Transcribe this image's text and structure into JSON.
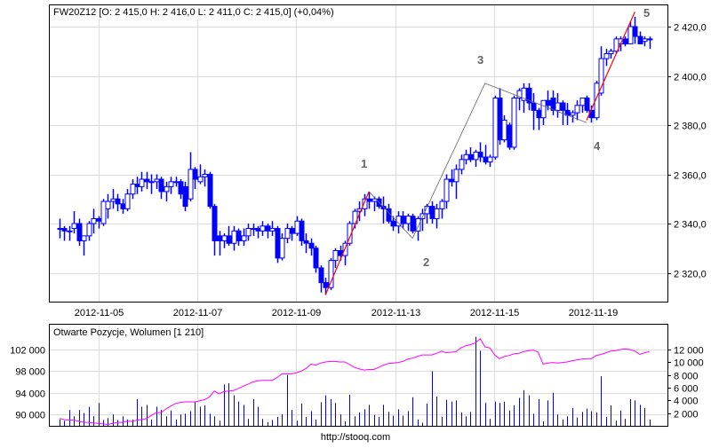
{
  "chart_data": [
    {
      "type": "candlestick",
      "title": "FW20Z12 [O: 2 415,0  H: 2 416,0  L: 2 411,0  C: 2 415,0] (+0,04%)",
      "colors": {
        "candle": "#0000ff",
        "grid": "#dcdcdc",
        "wave_up": "#ff0000",
        "wave_line": "#666666"
      },
      "ylim": [
        2308,
        2428
      ],
      "y_ticks": [
        {
          "value": 2420,
          "label": "2 420,0"
        },
        {
          "value": 2400,
          "label": "2 400,0"
        },
        {
          "value": 2380,
          "label": "2 380,0"
        },
        {
          "value": 2360,
          "label": "2 360,0"
        },
        {
          "value": 2340,
          "label": "2 340,0"
        },
        {
          "value": 2320,
          "label": "2 320,0"
        }
      ],
      "x_ticks": [
        {
          "bar": 8.1,
          "label": "2012-11-05"
        },
        {
          "bar": 28.5,
          "label": "2012-11-07"
        },
        {
          "bar": 48.9,
          "label": "2012-11-09"
        },
        {
          "bar": 69.5,
          "label": "2012-11-13"
        },
        {
          "bar": 89.9,
          "label": "2012-11-15"
        },
        {
          "bar": 110.3,
          "label": "2012-11-19"
        }
      ],
      "ohlc": [
        [
          2338,
          2342,
          2334,
          2338
        ],
        [
          2338,
          2339,
          2333,
          2337
        ],
        [
          2337,
          2339,
          2333,
          2337
        ],
        [
          2338,
          2345,
          2336,
          2340
        ],
        [
          2340,
          2342,
          2331,
          2333
        ],
        [
          2333,
          2335,
          2327,
          2335
        ],
        [
          2335,
          2341,
          2333,
          2340
        ],
        [
          2340,
          2346,
          2336,
          2342
        ],
        [
          2342,
          2343,
          2338,
          2341
        ],
        [
          2340,
          2350,
          2339,
          2349
        ],
        [
          2346,
          2352,
          2342,
          2349
        ],
        [
          2349,
          2354,
          2346,
          2350
        ],
        [
          2350,
          2352,
          2345,
          2348
        ],
        [
          2348,
          2350,
          2344,
          2346
        ],
        [
          2346,
          2354,
          2345,
          2352
        ],
        [
          2352,
          2358,
          2350,
          2356
        ],
        [
          2356,
          2359,
          2352,
          2355
        ],
        [
          2355,
          2361,
          2353,
          2358
        ],
        [
          2358,
          2361,
          2354,
          2357
        ],
        [
          2357,
          2360,
          2352,
          2357
        ],
        [
          2357,
          2360,
          2354,
          2358
        ],
        [
          2358,
          2359,
          2350,
          2353
        ],
        [
          2353,
          2357,
          2349,
          2355
        ],
        [
          2355,
          2359,
          2352,
          2357
        ],
        [
          2357,
          2359,
          2355,
          2357
        ],
        [
          2357,
          2358,
          2350,
          2352
        ],
        [
          2355,
          2357,
          2345,
          2347
        ],
        [
          2350,
          2369,
          2349,
          2362
        ],
        [
          2362,
          2363,
          2354,
          2358
        ],
        [
          2357,
          2364,
          2356,
          2359
        ],
        [
          2359,
          2362,
          2355,
          2360
        ],
        [
          2360,
          2361,
          2346,
          2347
        ],
        [
          2347,
          2348,
          2327,
          2333
        ],
        [
          2335,
          2337,
          2327,
          2333
        ],
        [
          2333,
          2336,
          2330,
          2335
        ],
        [
          2335,
          2339,
          2331,
          2332
        ],
        [
          2332,
          2339,
          2329,
          2337
        ],
        [
          2337,
          2338,
          2331,
          2333
        ],
        [
          2333,
          2338,
          2331,
          2335
        ],
        [
          2335,
          2340,
          2333,
          2338
        ],
        [
          2338,
          2340,
          2335,
          2338
        ],
        [
          2338,
          2339,
          2334,
          2337
        ],
        [
          2337,
          2341,
          2335,
          2339
        ],
        [
          2339,
          2340,
          2334,
          2337
        ],
        [
          2337,
          2341,
          2335,
          2338
        ],
        [
          2338,
          2339,
          2324,
          2326
        ],
        [
          2326,
          2336,
          2325,
          2334
        ],
        [
          2334,
          2340,
          2332,
          2338
        ],
        [
          2338,
          2339,
          2333,
          2336
        ],
        [
          2336,
          2343,
          2335,
          2341
        ],
        [
          2341,
          2342,
          2331,
          2333
        ],
        [
          2333,
          2336,
          2328,
          2332
        ],
        [
          2332,
          2334,
          2327,
          2330
        ],
        [
          2330,
          2331,
          2320,
          2322
        ],
        [
          2322,
          2323,
          2312,
          2316
        ],
        [
          2316,
          2318,
          2311,
          2314
        ],
        [
          2314,
          2326,
          2313,
          2325
        ],
        [
          2325,
          2330,
          2322,
          2329
        ],
        [
          2329,
          2331,
          2325,
          2327
        ],
        [
          2327,
          2333,
          2323,
          2332
        ],
        [
          2332,
          2341,
          2331,
          2340
        ],
        [
          2340,
          2346,
          2338,
          2345
        ],
        [
          2345,
          2349,
          2341,
          2346
        ],
        [
          2346,
          2352,
          2343,
          2350
        ],
        [
          2350,
          2353,
          2346,
          2349
        ],
        [
          2349,
          2351,
          2345,
          2350
        ],
        [
          2350,
          2351,
          2346,
          2347
        ],
        [
          2347,
          2351,
          2340,
          2346
        ],
        [
          2346,
          2348,
          2340,
          2341
        ],
        [
          2341,
          2343,
          2337,
          2339
        ],
        [
          2339,
          2345,
          2336,
          2343
        ],
        [
          2343,
          2345,
          2338,
          2340
        ],
        [
          2340,
          2344,
          2337,
          2343
        ],
        [
          2343,
          2344,
          2336,
          2337
        ],
        [
          2337,
          2343,
          2333,
          2342
        ],
        [
          2342,
          2346,
          2337,
          2344
        ],
        [
          2344,
          2348,
          2340,
          2347
        ],
        [
          2347,
          2349,
          2340,
          2342
        ],
        [
          2342,
          2348,
          2338,
          2346
        ],
        [
          2346,
          2350,
          2342,
          2349
        ],
        [
          2349,
          2360,
          2346,
          2358
        ],
        [
          2358,
          2362,
          2355,
          2357
        ],
        [
          2357,
          2364,
          2350,
          2362
        ],
        [
          2362,
          2368,
          2360,
          2366
        ],
        [
          2366,
          2370,
          2364,
          2368
        ],
        [
          2368,
          2371,
          2365,
          2366
        ],
        [
          2366,
          2370,
          2363,
          2369
        ],
        [
          2369,
          2373,
          2365,
          2367
        ],
        [
          2367,
          2372,
          2364,
          2365
        ],
        [
          2365,
          2368,
          2363,
          2367
        ],
        [
          2367,
          2392,
          2366,
          2391
        ],
        [
          2391,
          2395,
          2372,
          2374
        ],
        [
          2374,
          2384,
          2373,
          2382
        ],
        [
          2380,
          2381,
          2370,
          2371
        ],
        [
          2371,
          2392,
          2370,
          2391
        ],
        [
          2391,
          2395,
          2386,
          2394
        ],
        [
          2390,
          2397,
          2385,
          2395
        ],
        [
          2395,
          2397,
          2386,
          2389
        ],
        [
          2389,
          2393,
          2378,
          2386
        ],
        [
          2386,
          2387,
          2378,
          2383
        ],
        [
          2383,
          2390,
          2380,
          2390
        ],
        [
          2390,
          2394,
          2386,
          2388
        ],
        [
          2391,
          2394,
          2384,
          2386
        ],
        [
          2386,
          2393,
          2383,
          2389
        ],
        [
          2389,
          2390,
          2380,
          2386
        ],
        [
          2386,
          2389,
          2380,
          2384
        ],
        [
          2384,
          2386,
          2381,
          2385
        ],
        [
          2385,
          2390,
          2382,
          2388
        ],
        [
          2388,
          2391,
          2385,
          2391
        ],
        [
          2391,
          2392,
          2385,
          2386
        ],
        [
          2386,
          2388,
          2381,
          2383
        ],
        [
          2383,
          2398,
          2382,
          2397
        ],
        [
          2393,
          2412,
          2392,
          2407
        ],
        [
          2407,
          2411,
          2404,
          2409
        ],
        [
          2409,
          2411,
          2407,
          2410
        ],
        [
          2410,
          2416,
          2409,
          2415
        ],
        [
          2413,
          2416,
          2410,
          2415
        ],
        [
          2415,
          2416,
          2412,
          2413
        ],
        [
          2413,
          2422,
          2413,
          2420
        ],
        [
          2420,
          2424,
          2413,
          2416
        ],
        [
          2416,
          2418,
          2413,
          2413
        ],
        [
          2414,
          2416,
          2412,
          2415
        ],
        [
          2415,
          2416,
          2411,
          2415
        ]
      ],
      "waves": [
        {
          "from": {
            "bar": 55,
            "price": 2311
          },
          "to": {
            "bar": 64,
            "price": 2353
          },
          "style": "up"
        },
        {
          "from": {
            "bar": 64,
            "price": 2353
          },
          "to": {
            "bar": 73,
            "price": 2334
          },
          "style": "line"
        },
        {
          "from": {
            "bar": 73,
            "price": 2334
          },
          "to": {
            "bar": 88,
            "price": 2397
          },
          "style": "line"
        },
        {
          "from": {
            "bar": 88,
            "price": 2397
          },
          "to": {
            "bar": 109,
            "price": 2381
          },
          "style": "line"
        },
        {
          "from": {
            "bar": 109,
            "price": 2382
          },
          "to": {
            "bar": 119,
            "price": 2426
          },
          "style": "up"
        }
      ],
      "wave_labels": [
        "1",
        "2",
        "3",
        "4",
        "5"
      ]
    },
    {
      "type": "bar+line",
      "title": "Otwarte Pozycje, Wolumen [1 210]",
      "colors": {
        "volume": "#0000ff",
        "open_interest": "#ff00ff"
      },
      "left_ylim": [
        87700,
        106000
      ],
      "right_ylim": [
        0,
        16000
      ],
      "left_ticks": [
        {
          "value": 102000,
          "label": "102 000"
        },
        {
          "value": 98000,
          "label": "98 000"
        },
        {
          "value": 94000,
          "label": "94 000"
        },
        {
          "value": 90000,
          "label": "90 000"
        }
      ],
      "right_ticks": [
        {
          "value": 12000,
          "label": "12 000"
        },
        {
          "value": 10000,
          "label": "10 000"
        },
        {
          "value": 8000,
          "label": "8 000"
        },
        {
          "value": 6000,
          "label": "6 000"
        },
        {
          "value": 4000,
          "label": "4 000"
        },
        {
          "value": 2000,
          "label": "2 000"
        }
      ],
      "volume": [
        1000,
        800,
        2500,
        1500,
        2500,
        2000,
        3000,
        1500,
        3600,
        900,
        1200,
        1800,
        900,
        1500,
        1000,
        1000,
        4200,
        3000,
        3300,
        1000,
        3000,
        2500,
        1500,
        2400,
        1000,
        1800,
        1900,
        2300,
        3700,
        3000,
        3200,
        1900,
        1500,
        800,
        6500,
        6700,
        4800,
        3800,
        3300,
        1100,
        4200,
        3000,
        1100,
        600,
        900,
        1400,
        1800,
        8000,
        2500,
        800,
        3500,
        1400,
        2300,
        1000,
        3700,
        4800,
        4200,
        3600,
        1800,
        700,
        4900,
        1500,
        2100,
        2600,
        3300,
        1700,
        1400,
        3300,
        2200,
        1600,
        2600,
        1600,
        2300,
        4500,
        1000,
        500,
        3500,
        8600,
        4600,
        1400,
        4100,
        3800,
        4000,
        2100,
        1500,
        2200,
        14000,
        11800,
        3600,
        1100,
        3800,
        3600,
        3800,
        2400,
        3200,
        4400,
        5600,
        4800,
        1900,
        4200,
        700,
        4000,
        5200,
        1800,
        1000,
        1500,
        2800,
        1300,
        2200,
        2700,
        2300,
        2100,
        7800,
        1400,
        3200,
        800,
        2400,
        1100,
        4200,
        4000,
        3300,
        2800,
        1000
      ],
      "open_interest": [
        89200,
        89000,
        88900,
        88900,
        88700,
        88500,
        88500,
        88400,
        88300,
        88200,
        88100,
        88300,
        88500,
        88500,
        88700,
        88700,
        88900,
        89000,
        89200,
        89800,
        90300,
        90300,
        91000,
        91500,
        92000,
        92200,
        92300,
        92300,
        92300,
        92500,
        92700,
        93200,
        94300,
        93800,
        94200,
        94300,
        94400,
        94800,
        95200,
        95600,
        96000,
        96200,
        96300,
        96300,
        96300,
        96800,
        97500,
        97500,
        97500,
        97700,
        98000,
        98500,
        99300,
        99100,
        99500,
        99700,
        99800,
        99800,
        99700,
        99700,
        99200,
        98700,
        98400,
        98200,
        98300,
        98300,
        98700,
        99100,
        99400,
        99500,
        99600,
        99800,
        100200,
        100400,
        100700,
        101000,
        101000,
        101000,
        101300,
        101700,
        101400,
        101500,
        101600,
        102300,
        102700,
        102900,
        103200,
        104000,
        102500,
        102300,
        101000,
        100300,
        100700,
        100900,
        101200,
        101300,
        101600,
        101800,
        101900,
        101500,
        99300,
        99500,
        99600,
        99500,
        99600,
        99700,
        99900,
        100100,
        100200,
        100300,
        100300,
        100900,
        101100,
        101400,
        101700,
        101800,
        102000,
        102100,
        102000,
        101700,
        101100,
        101400,
        101600
      ]
    }
  ],
  "footer": {
    "source": "http://stooq.com"
  }
}
